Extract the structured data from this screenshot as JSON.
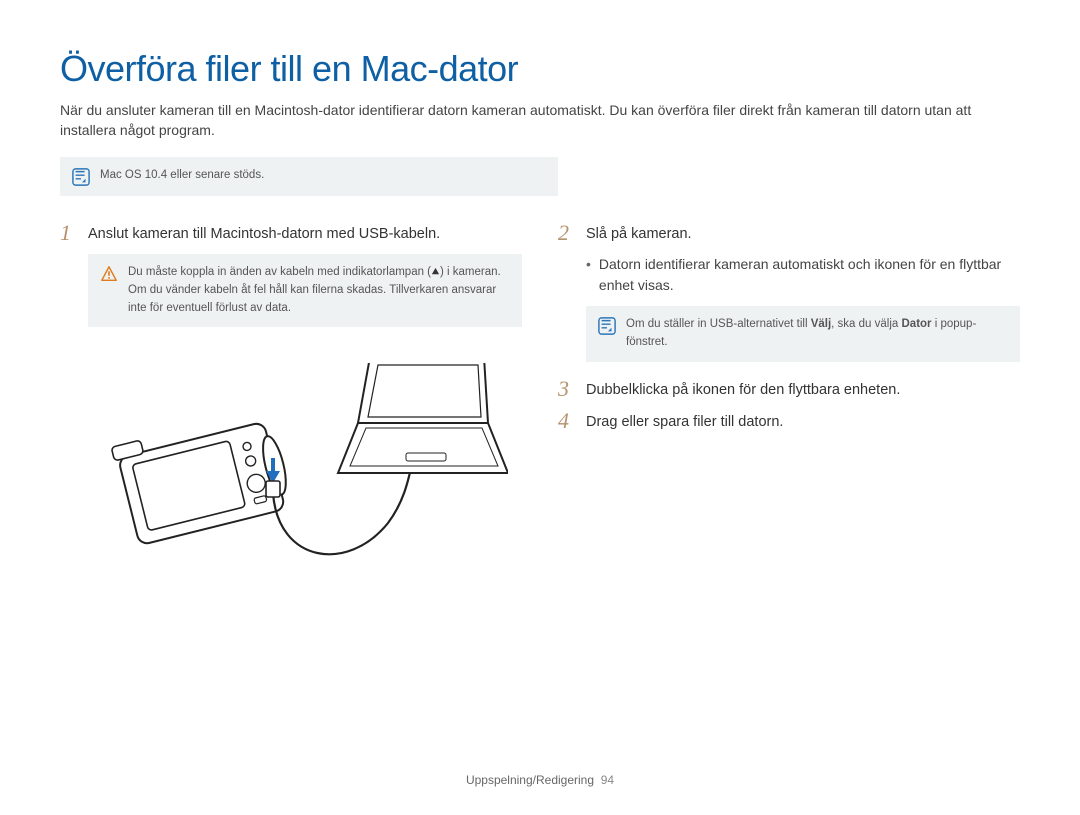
{
  "title": "Överföra filer till en Mac-dator",
  "intro": "När du ansluter kameran till en Macintosh-dator identifierar datorn kameran automatiskt. Du kan överföra filer direkt från kameran till datorn utan att installera något program.",
  "top_note": "Mac OS 10.4 eller senare stöds.",
  "left": {
    "step1_num": "1",
    "step1": "Anslut kameran till Macintosh-datorn med USB-kabeln.",
    "warn_pre": "Du måste koppla in änden av kabeln med indikatorlampan (",
    "warn_post": ") i kameran. Om du vänder kabeln åt fel håll kan filerna skadas. Tillverkaren ansvarar inte för eventuell förlust av data."
  },
  "right": {
    "step2_num": "2",
    "step2": "Slå på kameran.",
    "bullet1": "Datorn identifierar kameran automatiskt och ikonen för en flyttbar enhet visas.",
    "note_a": "Om du ställer in USB-alternativet till ",
    "note_b": "Välj",
    "note_c": ", ska du välja ",
    "note_d": "Dator",
    "note_e": " i popup-fönstret.",
    "step3_num": "3",
    "step3": "Dubbelklicka på ikonen för den flyttbara enheten.",
    "step4_num": "4",
    "step4": "Drag eller spara filer till datorn."
  },
  "footer": {
    "section": "Uppspelning/Redigering",
    "page": "94"
  }
}
